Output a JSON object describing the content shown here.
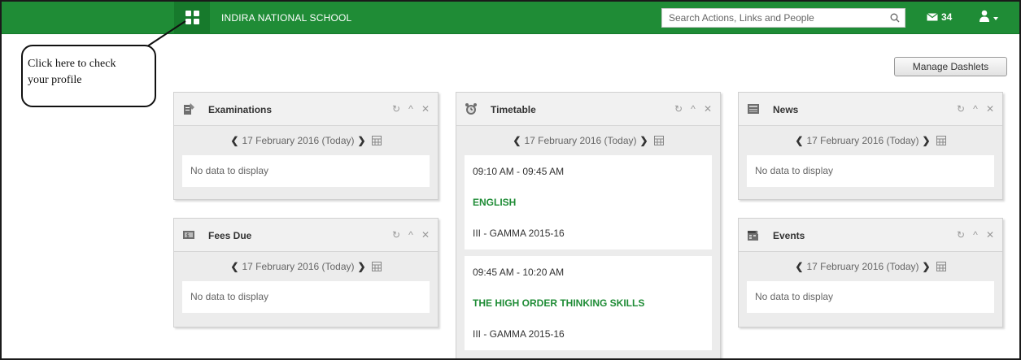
{
  "header": {
    "school_name": "INDIRA NATIONAL SCHOOL",
    "search_placeholder": "Search Actions, Links and People",
    "mail_count": "34",
    "brand_color": "#1f8c36"
  },
  "callout": {
    "line1": "Click here to check",
    "line2": "your profile"
  },
  "manage_label": "Manage Dashlets",
  "dashlets": {
    "examinations": {
      "title": "Examinations",
      "icon": "examinations-icon",
      "date": "17 February 2016 (Today)",
      "empty": "No data to display"
    },
    "fees": {
      "title": "Fees Due",
      "icon": "fees-icon",
      "date": "17 February 2016 (Today)",
      "empty": "No data to display"
    },
    "timetable": {
      "title": "Timetable",
      "icon": "alarm-clock-icon",
      "date": "17 February 2016 (Today)",
      "slots": [
        {
          "time": "09:10 AM - 09:45 AM",
          "subject": "ENGLISH",
          "class": "III - GAMMA 2015-16"
        },
        {
          "time": "09:45 AM - 10:20 AM",
          "subject": "THE HIGH ORDER THINKING SKILLS",
          "class": "III - GAMMA 2015-16"
        }
      ]
    },
    "news": {
      "title": "News",
      "icon": "news-icon",
      "date": "17 February 2016 (Today)",
      "empty": "No data to display"
    },
    "events": {
      "title": "Events",
      "icon": "events-icon",
      "date": "17 February 2016 (Today)",
      "empty": "No data to display"
    }
  }
}
